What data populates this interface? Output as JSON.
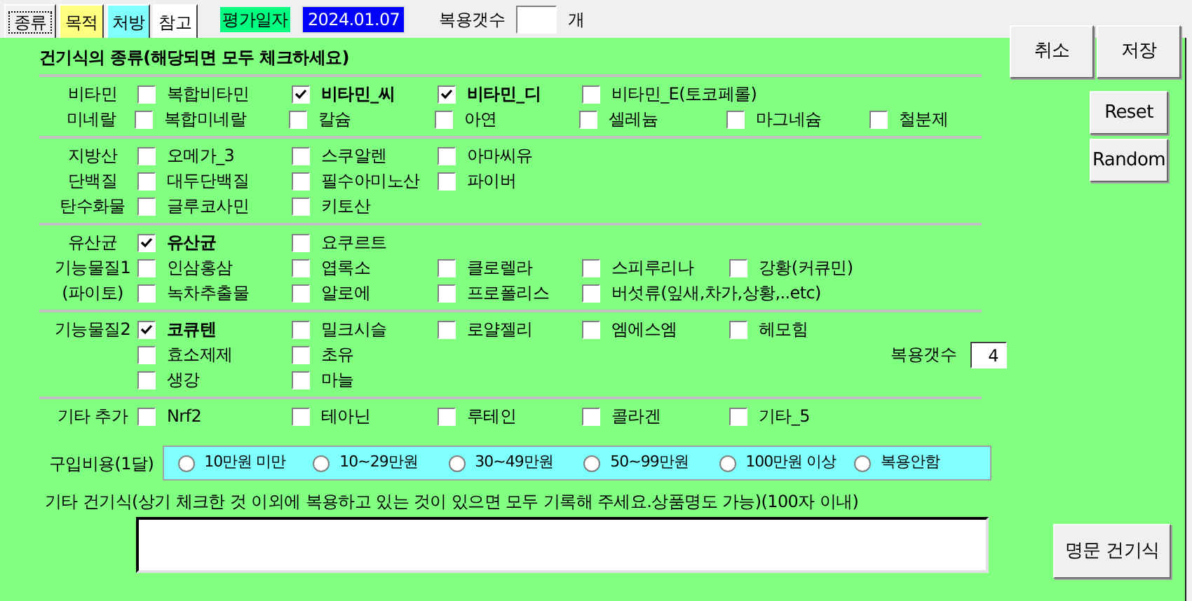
{
  "tabs": [
    {
      "label": "종류",
      "selected": true,
      "color": "#f0f0f0"
    },
    {
      "label": "목적",
      "selected": false,
      "color": "#ffff80"
    },
    {
      "label": "처방",
      "selected": false,
      "color": "#80ffff"
    },
    {
      "label": "참고",
      "selected": false,
      "color": "#ffffff"
    }
  ],
  "eval_date": {
    "label": "평가일자",
    "value": "2024.01.07"
  },
  "dose_count": {
    "label": "복용갯수",
    "unit": "개"
  },
  "top_buttons": [
    "취소",
    "저장"
  ],
  "side_buttons": [
    "Reset",
    "Random"
  ],
  "section_title": "건기식의 종류(해당되면 모두 체크하세요)",
  "groups": [
    {
      "rows": [
        {
          "label": "비타민",
          "items": [
            {
              "label": "복합비타민",
              "checked": false
            },
            {
              "label": "비타민_씨",
              "checked": true
            },
            {
              "label": "비타민_디",
              "checked": true
            },
            {
              "label": "비타민_E(토코페롤)",
              "checked": false
            }
          ]
        },
        {
          "label": "미네랄",
          "items": [
            {
              "label": "복합미네랄",
              "checked": false
            },
            {
              "label": "칼슘",
              "checked": false
            },
            {
              "label": "아연",
              "checked": false
            },
            {
              "label": "셀레늄",
              "checked": false
            },
            {
              "label": "마그네슘",
              "checked": false
            },
            {
              "label": "철분제",
              "checked": false
            }
          ]
        }
      ]
    },
    {
      "rows": [
        {
          "label": "지방산",
          "items": [
            {
              "label": "오메가_3",
              "checked": false
            },
            {
              "label": "스쿠알렌",
              "checked": false
            },
            {
              "label": "아마씨유",
              "checked": false
            }
          ]
        },
        {
          "label": "단백질",
          "items": [
            {
              "label": "대두단백질",
              "checked": false
            },
            {
              "label": "필수아미노산",
              "checked": false
            },
            {
              "label": "파이버",
              "checked": false
            }
          ]
        },
        {
          "label": "탄수화물",
          "items": [
            {
              "label": "글루코사민",
              "checked": false
            },
            {
              "label": "키토산",
              "checked": false
            }
          ]
        }
      ]
    },
    {
      "rows": [
        {
          "label": "유산균",
          "items": [
            {
              "label": "유산균",
              "checked": true
            },
            {
              "label": "요쿠르트",
              "checked": false
            }
          ]
        },
        {
          "label": "기능물질1",
          "items": [
            {
              "label": "인삼홍삼",
              "checked": false
            },
            {
              "label": "엽록소",
              "checked": false
            },
            {
              "label": "클로렐라",
              "checked": false
            },
            {
              "label": "스피루리나",
              "checked": false
            },
            {
              "label": "강황(커큐민)",
              "checked": false
            }
          ]
        },
        {
          "label": "(파이토)",
          "items": [
            {
              "label": "녹차추출물",
              "checked": false
            },
            {
              "label": "알로에",
              "checked": false
            },
            {
              "label": "프로폴리스",
              "checked": false
            },
            {
              "label": "버섯류(잎새,차가,상황,..etc)",
              "checked": false
            }
          ]
        }
      ]
    },
    {
      "rows": [
        {
          "label": "기능물질2",
          "items": [
            {
              "label": "코큐텐",
              "checked": true
            },
            {
              "label": "밀크시슬",
              "checked": false
            },
            {
              "label": "로얄젤리",
              "checked": false
            },
            {
              "label": "엠에스엠",
              "checked": false
            },
            {
              "label": "헤모힘",
              "checked": false
            }
          ]
        },
        {
          "items": [
            {
              "label": "효소제제",
              "checked": false
            },
            {
              "label": "초유",
              "checked": false
            }
          ],
          "count": {
            "label": "복용갯수",
            "value": "4"
          }
        },
        {
          "items": [
            {
              "label": "생강",
              "checked": false
            },
            {
              "label": "마늘",
              "checked": false
            }
          ]
        }
      ]
    },
    {
      "rows": [
        {
          "label": "기타 추가",
          "items": [
            {
              "label": "Nrf2",
              "checked": false
            },
            {
              "label": "테아닌",
              "checked": false
            },
            {
              "label": "루테인",
              "checked": false
            },
            {
              "label": "콜라겐",
              "checked": false
            },
            {
              "label": "기타_5",
              "checked": false
            }
          ]
        }
      ]
    }
  ],
  "cost": {
    "label": "구입비용(1달)",
    "options": [
      {
        "label": "10만원 미만",
        "selected": false
      },
      {
        "label": "10~29만원",
        "selected": false
      },
      {
        "label": "30~49만원",
        "selected": false
      },
      {
        "label": "50~99만원",
        "selected": false
      },
      {
        "label": "100만원 이상",
        "selected": false
      },
      {
        "label": "복용안함",
        "selected": false
      }
    ]
  },
  "other": {
    "label": "기타 건기식(상기 체크한 것 이외에 복용하고 있는 것이 있으면 모두 기록해 주세요.상품명도 가능)(100자 이내)",
    "button": "명문 건기식"
  }
}
